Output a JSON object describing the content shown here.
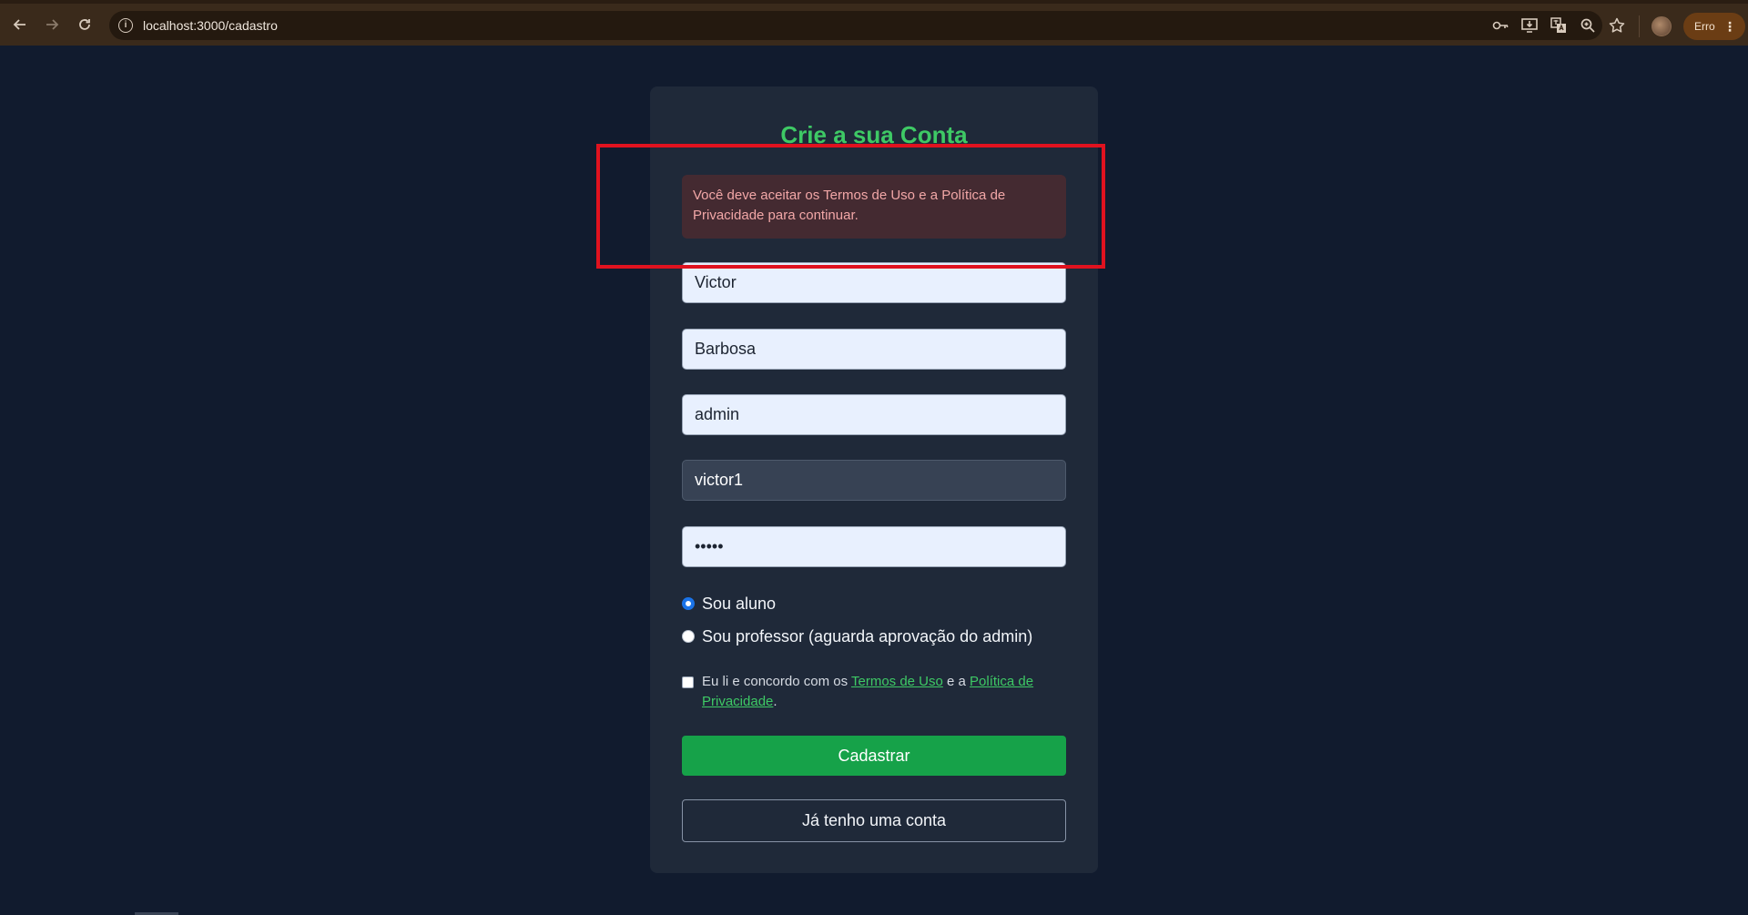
{
  "browser": {
    "url": "localhost:3000/cadastro",
    "profile_status": "Erro",
    "icons": [
      "back-icon",
      "forward-icon",
      "reload-icon",
      "site-info-icon",
      "password-key-icon",
      "install-app-icon",
      "translate-icon",
      "zoom-icon",
      "bookmark-star-icon",
      "avatar",
      "menu-dots-icon"
    ]
  },
  "page": {
    "title": "Crie a sua Conta",
    "error_message": "Você deve aceitar os Termos de Uso e a Política de Privacidade para continuar.",
    "fields": {
      "first_name": "Victor",
      "last_name": "Barbosa",
      "username": "admin",
      "email": "victor1",
      "password": "•••••"
    },
    "role_options": {
      "student": "Sou aluno",
      "teacher": "Sou professor (aguarda aprovação do admin)",
      "selected": "student"
    },
    "terms": {
      "prefix": "Eu li e concordo com os ",
      "terms_link": "Termos de Uso",
      "middle": " e a ",
      "privacy_link": "Política de Privacidade",
      "suffix": "."
    },
    "submit_label": "Cadastrar",
    "login_label": "Já tenho uma conta"
  },
  "colors": {
    "page_bg": "#111b2e",
    "card_bg": "#1f2939",
    "accent_green": "#3ec965",
    "button_green": "#16a249",
    "error_bg": "#442a31",
    "error_text": "#f2a7a7",
    "highlight_red": "#e0121f"
  }
}
